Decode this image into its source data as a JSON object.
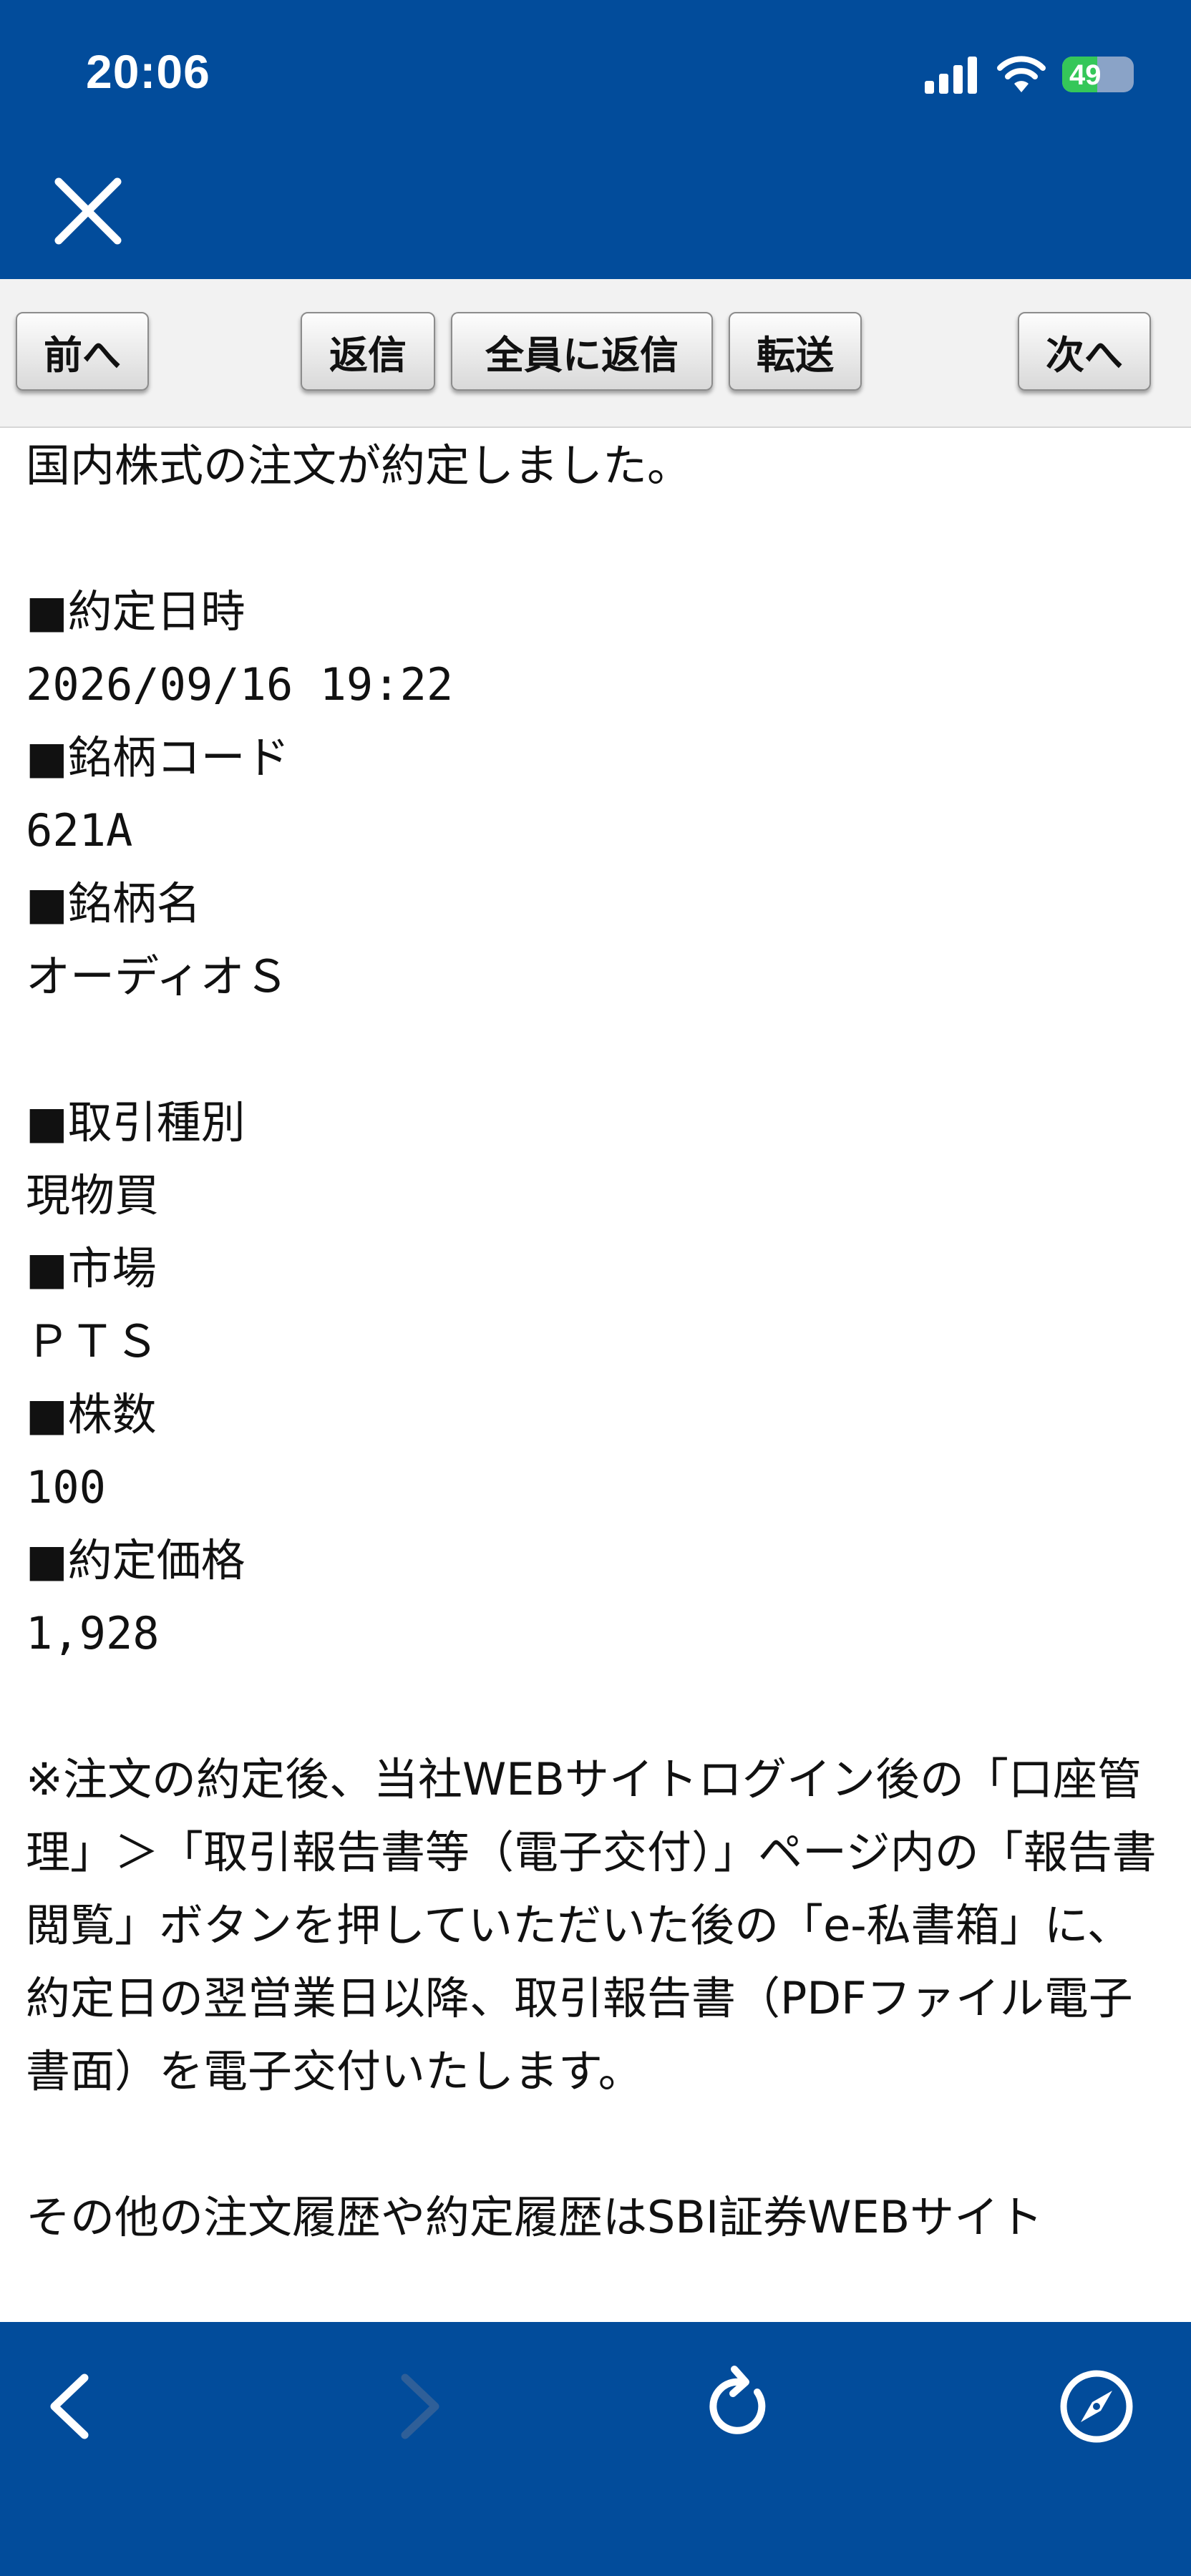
{
  "status_bar": {
    "time": "20:06",
    "battery_level": "49",
    "battery_fraction": 0.49
  },
  "toolbar": {
    "prev_label": "前へ",
    "reply_label": "返信",
    "reply_all_label": "全員に返信",
    "forward_label": "転送",
    "next_label": "次へ"
  },
  "message": {
    "intro": "国内株式の注文が約定しました。",
    "exec_datetime_label": "■約定日時",
    "exec_datetime_value": "2026/09/16 19:22",
    "code_label": "■銘柄コード",
    "code_value": "621A",
    "name_label": "■銘柄名",
    "name_value": "オーディオＳ",
    "trade_type_label": "■取引種別",
    "trade_type_value": "現物買",
    "market_label": "■市場",
    "market_value": "ＰＴＳ",
    "shares_label": "■株数",
    "shares_value": "100",
    "price_label": "■約定価格",
    "price_value": "1,928",
    "note": "※注文の約定後、当社WEBサイトログイン後の「口座管理」＞「取引報告書等（電子交付）」ページ内の「報告書閲覧」ボタンを押していただいた後の「e-私書箱」に、約定日の翌営業日以降、取引報告書（PDFファイル電子書面）を電子交付いたします。",
    "footer_partial": "その他の注文履歴や約定履歴はSBI証券WEBサイト"
  },
  "colors": {
    "brand_blue": "#024c9b",
    "toolbar_bg": "#f2f2f2",
    "battery_green": "#35c759"
  },
  "icons": {
    "close": "close-icon",
    "back": "chevron-left-icon",
    "forward": "chevron-right-icon",
    "reload": "reload-icon",
    "browser": "compass-icon",
    "signal": "signal-icon",
    "wifi": "wifi-icon",
    "battery": "battery-icon"
  }
}
